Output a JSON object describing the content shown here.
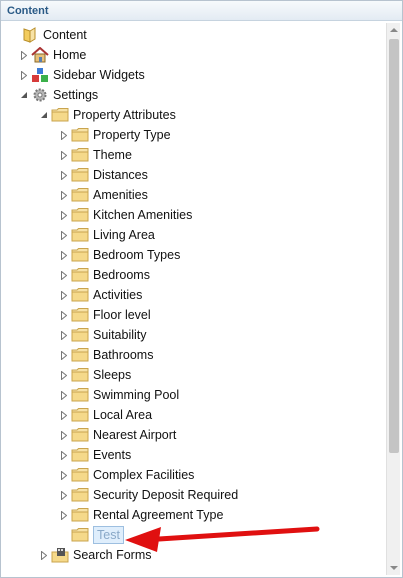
{
  "panel": {
    "title": "Content"
  },
  "tree": [
    {
      "label": "Content",
      "icon": "folder-icon",
      "twisty": "none"
    },
    {
      "label": "Home",
      "icon": "home-icon",
      "twisty": "collapsed"
    },
    {
      "label": "Sidebar Widgets",
      "icon": "widgets-icon",
      "twisty": "collapsed"
    },
    {
      "label": "Settings",
      "icon": "gear-icon",
      "twisty": "expanded"
    },
    {
      "label": "Property Attributes",
      "icon": "folder-icon",
      "twisty": "expanded"
    },
    {
      "label": "Property Type",
      "icon": "folder-icon",
      "twisty": "collapsed"
    },
    {
      "label": "Theme",
      "icon": "folder-icon",
      "twisty": "collapsed"
    },
    {
      "label": "Distances",
      "icon": "folder-icon",
      "twisty": "collapsed"
    },
    {
      "label": "Amenities",
      "icon": "folder-icon",
      "twisty": "collapsed"
    },
    {
      "label": "Kitchen Amenities",
      "icon": "folder-icon",
      "twisty": "collapsed"
    },
    {
      "label": "Living Area",
      "icon": "folder-icon",
      "twisty": "collapsed"
    },
    {
      "label": "Bedroom Types",
      "icon": "folder-icon",
      "twisty": "collapsed"
    },
    {
      "label": "Bedrooms",
      "icon": "folder-icon",
      "twisty": "collapsed"
    },
    {
      "label": "Activities",
      "icon": "folder-icon",
      "twisty": "collapsed"
    },
    {
      "label": "Floor level",
      "icon": "folder-icon",
      "twisty": "collapsed"
    },
    {
      "label": "Suitability",
      "icon": "folder-icon",
      "twisty": "collapsed"
    },
    {
      "label": "Bathrooms",
      "icon": "folder-icon",
      "twisty": "collapsed"
    },
    {
      "label": "Sleeps",
      "icon": "folder-icon",
      "twisty": "collapsed"
    },
    {
      "label": "Swimming Pool",
      "icon": "folder-icon",
      "twisty": "collapsed"
    },
    {
      "label": "Local Area",
      "icon": "folder-icon",
      "twisty": "collapsed"
    },
    {
      "label": "Nearest Airport",
      "icon": "folder-icon",
      "twisty": "collapsed"
    },
    {
      "label": "Events",
      "icon": "folder-icon",
      "twisty": "collapsed"
    },
    {
      "label": "Complex Facilities",
      "icon": "folder-icon",
      "twisty": "collapsed"
    },
    {
      "label": "Security Deposit Required",
      "icon": "folder-icon",
      "twisty": "collapsed"
    },
    {
      "label": "Rental Agreement Type",
      "icon": "folder-icon",
      "twisty": "collapsed"
    },
    {
      "label": "Test",
      "icon": "folder-icon",
      "twisty": "none",
      "editing": true
    },
    {
      "label": "Search Forms",
      "icon": "form-folder-icon",
      "twisty": "collapsed"
    }
  ],
  "colors": {
    "accent": "#2a5a86",
    "arrow": "#e01010",
    "folder": "#f5d98a"
  }
}
